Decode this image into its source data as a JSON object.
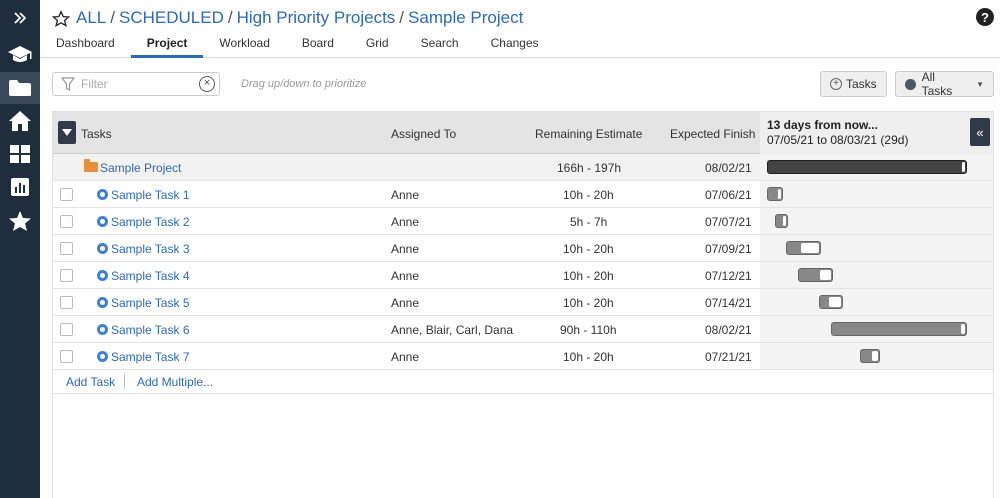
{
  "breadcrumb": {
    "items": [
      "ALL",
      "SCHEDULED",
      "High Priority Projects",
      "Sample Project"
    ],
    "separator": "/"
  },
  "help_label": "?",
  "tabs": [
    {
      "label": "Dashboard",
      "active": false
    },
    {
      "label": "Project",
      "active": true
    },
    {
      "label": "Workload",
      "active": false
    },
    {
      "label": "Board",
      "active": false
    },
    {
      "label": "Grid",
      "active": false
    },
    {
      "label": "Search",
      "active": false
    },
    {
      "label": "Changes",
      "active": false
    }
  ],
  "toolbar": {
    "filter_placeholder": "Filter",
    "clear_label": "×",
    "hint": "Drag up/down to prioritize",
    "tasks_button": "Tasks",
    "all_tasks_button": "All Tasks"
  },
  "grid": {
    "columns": {
      "tasks": "Tasks",
      "assigned": "Assigned To",
      "remaining": "Remaining Estimate",
      "finish": "Expected Finish"
    },
    "gantt_header": {
      "line1": "13 days from now...",
      "line2": "07/05/21 to 08/03/21 (29d)",
      "toggle": "«"
    },
    "project_row": {
      "name": "Sample Project",
      "remaining": "166h - 197h",
      "finish": "08/02/21",
      "bar": {
        "start": 0.0,
        "end": 0.97,
        "remaining_fraction": 0.01
      }
    },
    "rows": [
      {
        "name": "Sample Task 1",
        "assigned": "Anne",
        "remaining": "10h - 20h",
        "finish": "07/06/21",
        "bar": {
          "start": 0.0,
          "end": 0.08,
          "remaining_fraction": 0.2
        }
      },
      {
        "name": "Sample Task 2",
        "assigned": "Anne",
        "remaining": "5h - 7h",
        "finish": "07/07/21",
        "bar": {
          "start": 0.04,
          "end": 0.1,
          "remaining_fraction": 0.2
        }
      },
      {
        "name": "Sample Task 3",
        "assigned": "Anne",
        "remaining": "10h - 20h",
        "finish": "07/09/21",
        "bar": {
          "start": 0.09,
          "end": 0.26,
          "remaining_fraction": 0.5
        }
      },
      {
        "name": "Sample Task 4",
        "assigned": "Anne",
        "remaining": "10h - 20h",
        "finish": "07/12/21",
        "bar": {
          "start": 0.15,
          "end": 0.32,
          "remaining_fraction": 0.3
        }
      },
      {
        "name": "Sample Task 5",
        "assigned": "Anne",
        "remaining": "10h - 20h",
        "finish": "07/14/21",
        "bar": {
          "start": 0.25,
          "end": 0.37,
          "remaining_fraction": 0.5
        }
      },
      {
        "name": "Sample Task 6",
        "assigned": "Anne, Blair, Carl, Dana",
        "remaining": "90h - 110h",
        "finish": "08/02/21",
        "bar": {
          "start": 0.31,
          "end": 0.97,
          "remaining_fraction": 0.03
        }
      },
      {
        "name": "Sample Task 7",
        "assigned": "Anne",
        "remaining": "10h - 20h",
        "finish": "07/21/21",
        "bar": {
          "start": 0.45,
          "end": 0.55,
          "remaining_fraction": 0.3
        }
      }
    ],
    "add_task": "Add Task",
    "add_multiple": "Add Multiple..."
  },
  "colors": {
    "rail": "#1f2e3d",
    "link": "#2d6ab4",
    "folder": "#e88f3c",
    "task_dot": "#3f7fd1"
  },
  "icons": [
    "menu-expand-icon",
    "graduation-cap-icon",
    "folder-icon",
    "home-icon",
    "grid-icon",
    "bar-chart-icon",
    "star-icon",
    "favorite-star-icon",
    "help-icon",
    "filter-icon",
    "clear-icon",
    "plus-circle-icon",
    "caret-down-icon"
  ]
}
